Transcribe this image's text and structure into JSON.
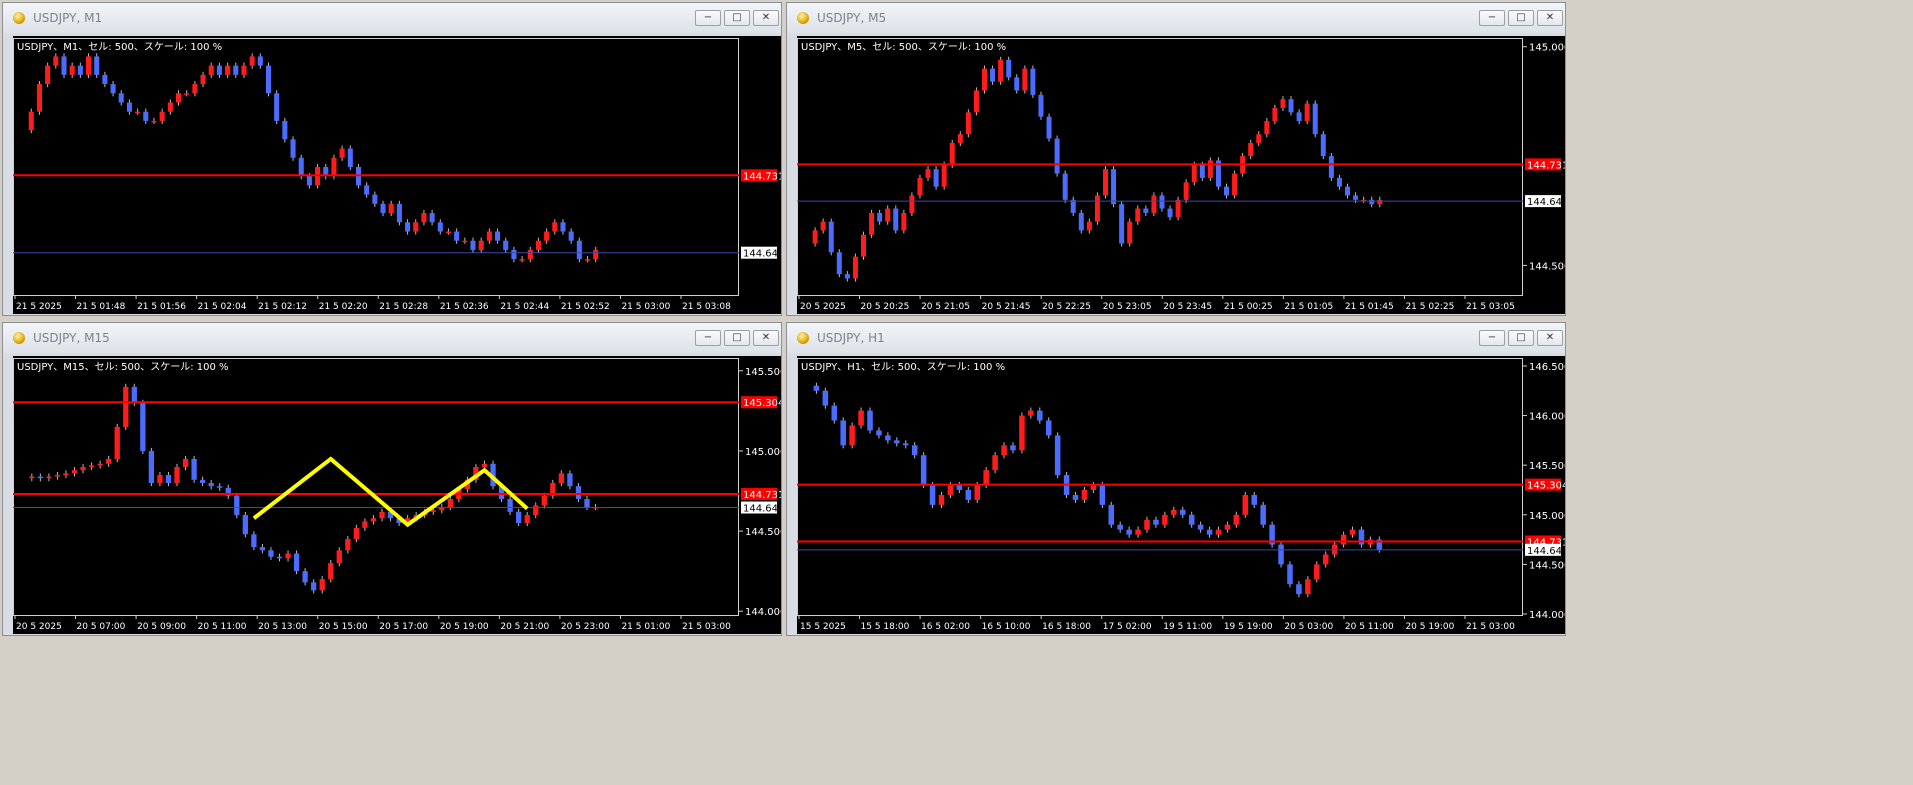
{
  "windows": [
    {
      "title": "USDJPY, M1",
      "caption": "USDJPY、M1、セル: 500、スケール: 100 %",
      "buttons": [
        "−",
        "□",
        "✕"
      ],
      "chart_data": {
        "type": "candlestick",
        "symbol": "USDJPY",
        "timeframe": "M1",
        "y_range": [
          144.6,
          144.88
        ],
        "price_labels": [],
        "time_labels": [
          "21 5 2025",
          "21 5 01:48",
          "21 5 01:56",
          "21 5 02:04",
          "21 5 02:12",
          "21 5 02:20",
          "21 5 02:28",
          "21 5 02:36",
          "21 5 02:44",
          "21 5 02:52",
          "21 5 03:00",
          "21 5 03:08"
        ],
        "levels": [
          {
            "price": 144.731,
            "label": "144.731",
            "color": "#ff0000"
          },
          {
            "price": 144.647,
            "label": "144.647",
            "color": "#1a2a8a",
            "current": true
          }
        ],
        "close_path": [
          144.78,
          144.8,
          144.83,
          144.85,
          144.86,
          144.84,
          144.85,
          144.84,
          144.86,
          144.84,
          144.83,
          144.82,
          144.81,
          144.8,
          144.8,
          144.79,
          144.79,
          144.8,
          144.81,
          144.82,
          144.82,
          144.83,
          144.84,
          144.85,
          144.84,
          144.85,
          144.84,
          144.85,
          144.86,
          144.85,
          144.82,
          144.79,
          144.77,
          144.75,
          144.73,
          144.72,
          144.74,
          144.73,
          144.75,
          144.76,
          144.74,
          144.72,
          144.71,
          144.7,
          144.69,
          144.7,
          144.68,
          144.67,
          144.68,
          144.69,
          144.68,
          144.67,
          144.67,
          144.66,
          144.66,
          144.65,
          144.66,
          144.67,
          144.66,
          144.65,
          144.64,
          144.64,
          144.65,
          144.66,
          144.67,
          144.68,
          144.67,
          144.66,
          144.64,
          144.64,
          144.65
        ]
      }
    },
    {
      "title": "USDJPY, M5",
      "caption": "USDJPY、M5、セル: 500、スケール: 100 %",
      "buttons": [
        "−",
        "□",
        "✕"
      ],
      "chart_data": {
        "type": "candlestick",
        "symbol": "USDJPY",
        "timeframe": "M5",
        "y_range": [
          144.43,
          145.02
        ],
        "price_labels": [
          "145.000",
          "144.500"
        ],
        "time_labels": [
          "20 5 2025",
          "20 5 20:25",
          "20 5 21:05",
          "20 5 21:45",
          "20 5 22:25",
          "20 5 23:05",
          "20 5 23:45",
          "21 5 00:25",
          "21 5 01:05",
          "21 5 01:45",
          "21 5 02:25",
          "21 5 03:05"
        ],
        "levels": [
          {
            "price": 144.731,
            "label": "144.731",
            "color": "#ff0000"
          },
          {
            "price": 144.647,
            "label": "144.647",
            "color": "#1a2a8a",
            "current": true
          }
        ],
        "close_path": [
          144.55,
          144.58,
          144.6,
          144.53,
          144.48,
          144.47,
          144.52,
          144.57,
          144.62,
          144.6,
          144.63,
          144.58,
          144.62,
          144.66,
          144.7,
          144.72,
          144.68,
          144.73,
          144.78,
          144.8,
          144.85,
          144.9,
          144.95,
          144.92,
          144.97,
          144.93,
          144.9,
          144.95,
          144.89,
          144.84,
          144.79,
          144.71,
          144.65,
          144.62,
          144.58,
          144.6,
          144.66,
          144.72,
          144.64,
          144.55,
          144.6,
          144.63,
          144.62,
          144.66,
          144.63,
          144.61,
          144.65,
          144.69,
          144.73,
          144.7,
          144.74,
          144.68,
          144.66,
          144.71,
          144.75,
          144.78,
          144.8,
          144.83,
          144.86,
          144.88,
          144.85,
          144.83,
          144.87,
          144.8,
          144.75,
          144.7,
          144.68,
          144.66,
          144.65,
          144.65,
          144.64,
          144.65
        ]
      }
    },
    {
      "title": "USDJPY, M15",
      "caption": "USDJPY、M15、セル: 500、スケール: 100 %",
      "buttons": [
        "−",
        "□",
        "✕"
      ],
      "chart_data": {
        "type": "candlestick",
        "symbol": "USDJPY",
        "timeframe": "M15",
        "y_range": [
          143.97,
          145.58
        ],
        "price_labels": [
          "145.500",
          "145.000",
          "144.500",
          "144.000"
        ],
        "time_labels": [
          "20 5 2025",
          "20 5 07:00",
          "20 5 09:00",
          "20 5 11:00",
          "20 5 13:00",
          "20 5 15:00",
          "20 5 17:00",
          "20 5 19:00",
          "20 5 21:00",
          "20 5 23:00",
          "21 5 01:00",
          "21 5 03:00"
        ],
        "levels": [
          {
            "price": 145.304,
            "label": "145.304",
            "color": "#ff0000"
          },
          {
            "price": 144.731,
            "label": "144.731",
            "color": "#ff0000"
          },
          {
            "price": 144.647,
            "label": "144.647",
            "color": "#1a2a8a",
            "current": true
          }
        ],
        "annotation": {
          "type": "zigzag",
          "color": "#ffff00",
          "points": [
            [
              27,
              144.58
            ],
            [
              36,
              144.95
            ],
            [
              45,
              144.54
            ],
            [
              54,
              144.88
            ],
            [
              59,
              144.64
            ]
          ]
        },
        "close_path": [
          144.83,
          144.84,
          144.83,
          144.84,
          144.85,
          144.86,
          144.88,
          144.9,
          144.91,
          144.92,
          144.95,
          145.15,
          145.4,
          145.3,
          145.0,
          144.8,
          144.85,
          144.8,
          144.9,
          144.95,
          144.82,
          144.8,
          144.78,
          144.77,
          144.72,
          144.6,
          144.48,
          144.4,
          144.38,
          144.34,
          144.33,
          144.36,
          144.25,
          144.18,
          144.13,
          144.2,
          144.3,
          144.38,
          144.45,
          144.52,
          144.56,
          144.58,
          144.62,
          144.58,
          144.55,
          144.58,
          144.6,
          144.62,
          144.63,
          144.65,
          144.7,
          144.76,
          144.82,
          144.9,
          144.92,
          144.78,
          144.7,
          144.62,
          144.55,
          144.6,
          144.66,
          144.72,
          144.8,
          144.86,
          144.78,
          144.7,
          144.65,
          144.65
        ]
      }
    },
    {
      "title": "USDJPY, H1",
      "caption": "USDJPY、H1、セル: 500、スケール: 100 %",
      "buttons": [
        "−",
        "□",
        "✕"
      ],
      "chart_data": {
        "type": "candlestick",
        "symbol": "USDJPY",
        "timeframe": "H1",
        "y_range": [
          143.98,
          146.58
        ],
        "price_labels": [
          "146.500",
          "146.000",
          "145.500",
          "145.000",
          "144.500",
          "144.000"
        ],
        "time_labels": [
          "15 5 2025",
          "15 5 18:00",
          "16 5 02:00",
          "16 5 10:00",
          "16 5 18:00",
          "17 5 02:00",
          "19 5 11:00",
          "19 5 19:00",
          "20 5 03:00",
          "20 5 11:00",
          "20 5 19:00",
          "21 5 03:00"
        ],
        "levels": [
          {
            "price": 145.304,
            "label": "145.304",
            "color": "#ff0000"
          },
          {
            "price": 144.731,
            "label": "144.731",
            "color": "#ff0000"
          },
          {
            "price": 144.647,
            "label": "144.647",
            "color": "#1a2a8a",
            "current": true
          }
        ],
        "close_path": [
          146.3,
          146.25,
          146.1,
          145.95,
          145.7,
          145.9,
          146.05,
          145.85,
          145.8,
          145.75,
          145.72,
          145.7,
          145.6,
          145.3,
          145.1,
          145.2,
          145.3,
          145.25,
          145.15,
          145.3,
          145.45,
          145.6,
          145.7,
          145.65,
          146.0,
          146.05,
          145.95,
          145.8,
          145.4,
          145.2,
          145.15,
          145.25,
          145.3,
          145.1,
          144.9,
          144.85,
          144.8,
          144.85,
          144.95,
          144.9,
          145.0,
          145.05,
          145.0,
          144.9,
          144.85,
          144.8,
          144.85,
          144.9,
          145.0,
          145.2,
          145.1,
          144.9,
          144.7,
          144.5,
          144.3,
          144.2,
          144.35,
          144.5,
          144.6,
          144.7,
          144.8,
          144.85,
          144.7,
          144.75,
          144.65
        ]
      }
    }
  ]
}
